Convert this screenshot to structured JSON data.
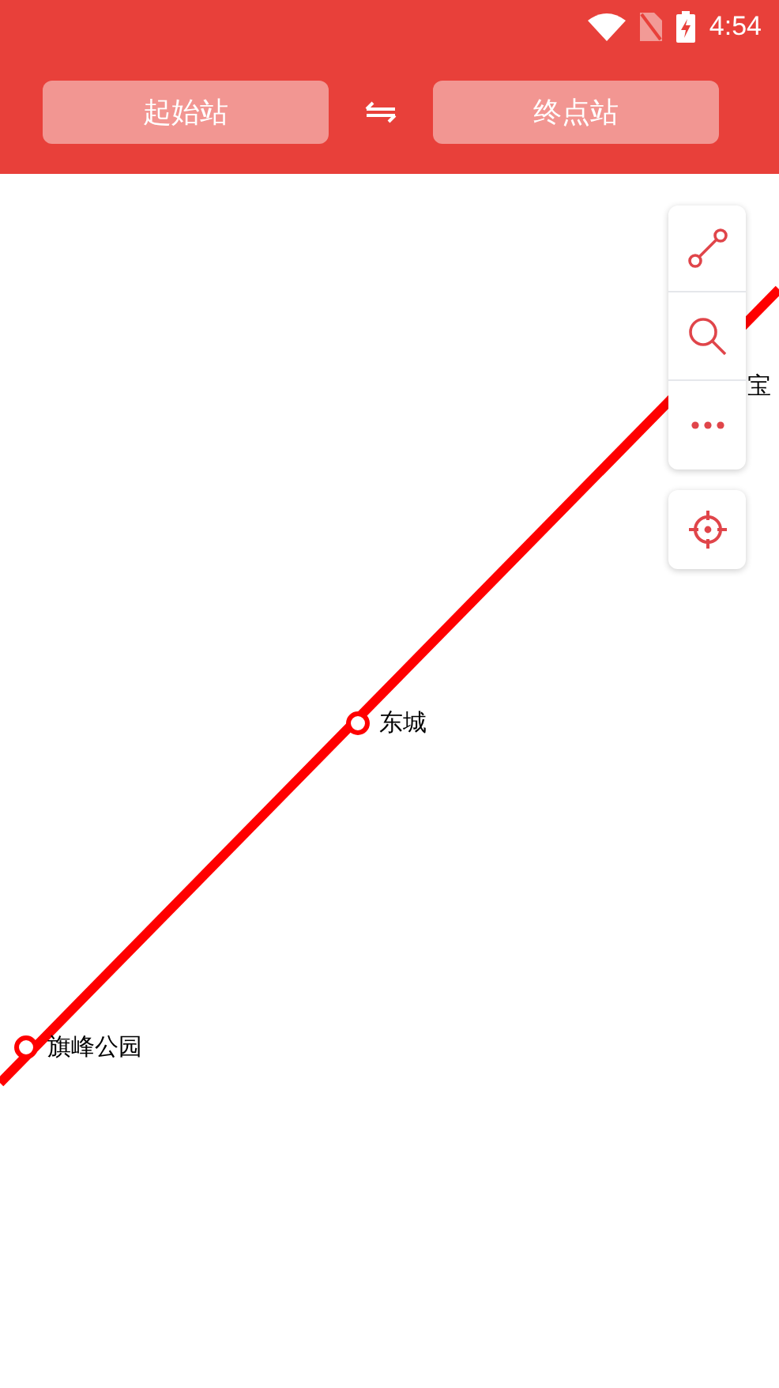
{
  "status_bar": {
    "time": "4:54"
  },
  "header": {
    "start_station": {
      "placeholder": "起始站"
    },
    "end_station": {
      "placeholder": "终点站"
    }
  },
  "map": {
    "stations": [
      {
        "name": "宝"
      },
      {
        "name": "东城"
      },
      {
        "name": "旗峰公园"
      }
    ]
  }
}
